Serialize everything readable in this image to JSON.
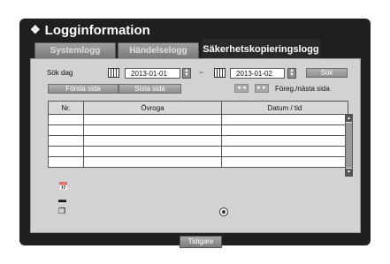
{
  "window": {
    "title": "Logginformation"
  },
  "tabs": [
    {
      "label": "Systemlogg",
      "active": false
    },
    {
      "label": "Händelselogg",
      "active": false
    },
    {
      "label": "Säkerhetskopieringslogg",
      "active": true
    }
  ],
  "search": {
    "label": "Sök dag",
    "start_date": "2013-01-01",
    "separator": "~",
    "end_date": "2013-01-02",
    "search_button": "Sök"
  },
  "paging": {
    "first_page": "Första sida",
    "last_page": "Sista sida",
    "prev_icon": "◄◄",
    "next_icon": "►►",
    "prev_next_label": "Föreg./nästa sida"
  },
  "table": {
    "columns": [
      "Nr.",
      "Övroga",
      "Datum / tid"
    ],
    "rows": [
      [
        "",
        "",
        ""
      ],
      [
        "",
        "",
        ""
      ],
      [
        "",
        "",
        ""
      ],
      [
        "",
        "",
        ""
      ],
      [
        "",
        "",
        ""
      ]
    ]
  },
  "legend": {
    "icons": [
      "calendar-icon",
      "device-icon",
      "copy-icon"
    ],
    "record_icon": "record-indicator-icon"
  },
  "footer": {
    "back_button": "Tidigare"
  },
  "colors": {
    "frame": "#1f1f1f",
    "panel": "#d2d2d2",
    "tab_active": "#2a2a2a",
    "button": "#9a9a9a"
  }
}
